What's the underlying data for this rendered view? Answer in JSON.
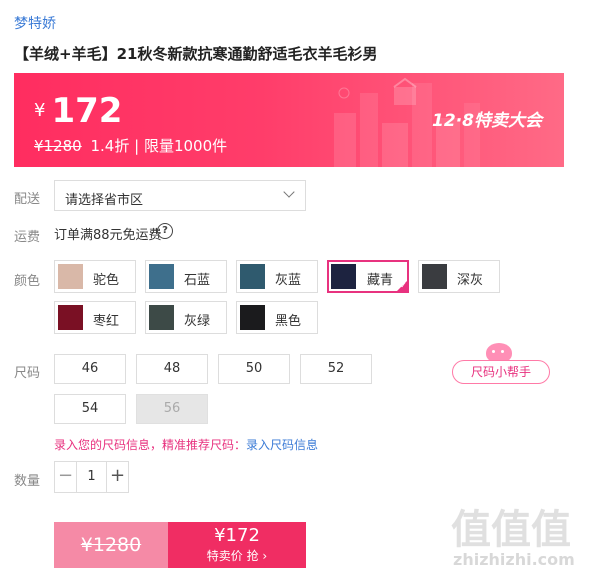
{
  "brand": "梦特娇",
  "product_title": "【羊绒+羊毛】21秋冬新款抗寒通勤舒适毛衣羊毛衫男",
  "banner": {
    "currency": "¥",
    "price": "172",
    "original_price": "¥1280",
    "discount_info": "1.4折 | 限量1000件",
    "event_name": "12·8特卖大会",
    "bg_color": "#ff2d60"
  },
  "delivery": {
    "label": "配送",
    "placeholder": "请选择省市区"
  },
  "shipping": {
    "label": "运费",
    "text": "订单满88元免运费",
    "help_icon": "?"
  },
  "color": {
    "label": "颜色",
    "options": [
      {
        "name": "驼色",
        "swatch": "#d9b8a8",
        "selected": false
      },
      {
        "name": "石蓝",
        "swatch": "#3e6f8c",
        "selected": false
      },
      {
        "name": "灰蓝",
        "swatch": "#2f5a6e",
        "selected": false
      },
      {
        "name": "藏青",
        "swatch": "#1d2340",
        "selected": true
      },
      {
        "name": "深灰",
        "swatch": "#3a3c40",
        "selected": false
      },
      {
        "name": "枣红",
        "swatch": "#7a1024",
        "selected": false
      },
      {
        "name": "灰绿",
        "swatch": "#3d4a47",
        "selected": false
      },
      {
        "name": "黑色",
        "swatch": "#1b1b1d",
        "selected": false
      }
    ],
    "accent_color": "#e8327f"
  },
  "size": {
    "label": "尺码",
    "options": [
      {
        "name": "46",
        "disabled": false
      },
      {
        "name": "48",
        "disabled": false
      },
      {
        "name": "50",
        "disabled": false
      },
      {
        "name": "52",
        "disabled": false
      },
      {
        "name": "54",
        "disabled": false
      },
      {
        "name": "56",
        "disabled": true
      }
    ],
    "helper_label": "尺码小帮手",
    "record_prompt": "录入您的尺码信息，精准推荐尺码：",
    "record_link": "录入尺码信息"
  },
  "quantity": {
    "label": "数量",
    "value": "1",
    "minus": "−",
    "plus": "+"
  },
  "buy_button": {
    "original_price": "¥1280",
    "price": "¥172",
    "action_label": "特卖价 抢 ›"
  },
  "watermark": {
    "title": "值值值",
    "subtitle": "zhizhizhi.com"
  }
}
